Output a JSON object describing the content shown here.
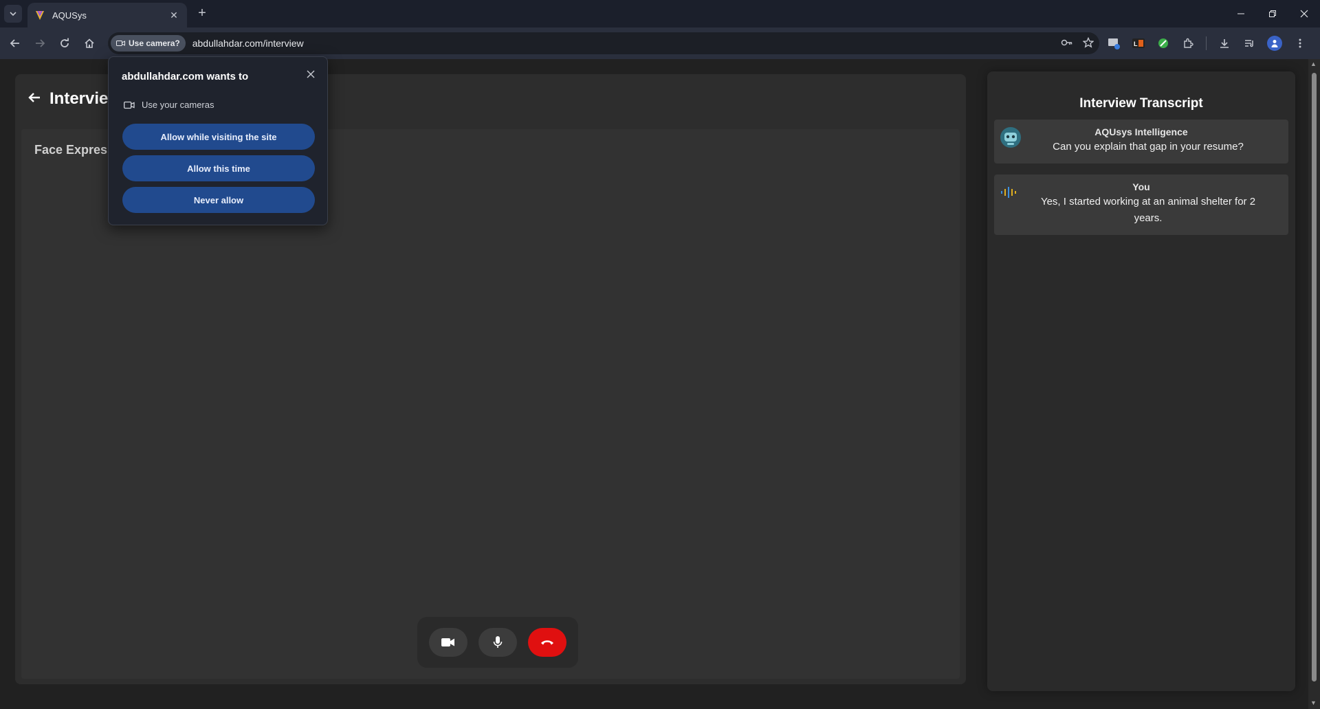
{
  "browser": {
    "tab_title": "AQUSys",
    "url": "abdullahdar.com/interview",
    "permission_chip": "Use camera?"
  },
  "popup": {
    "title": "abdullahdar.com wants to",
    "permission": "Use your cameras",
    "allow_visiting": "Allow while visiting the site",
    "allow_once": "Allow this time",
    "never_allow": "Never allow"
  },
  "main": {
    "title": "Intervie",
    "video_label": "Face Express"
  },
  "transcript": {
    "title": "Interview Transcript",
    "messages": [
      {
        "sender": "AQUsys Intelligence",
        "text": "Can you explain that gap in your resume?"
      },
      {
        "sender": "You",
        "text": "Yes, I started working at an animal shelter for 2 years."
      }
    ]
  },
  "colors": {
    "end_call": "#e01010",
    "popup_button": "#214a8e"
  }
}
